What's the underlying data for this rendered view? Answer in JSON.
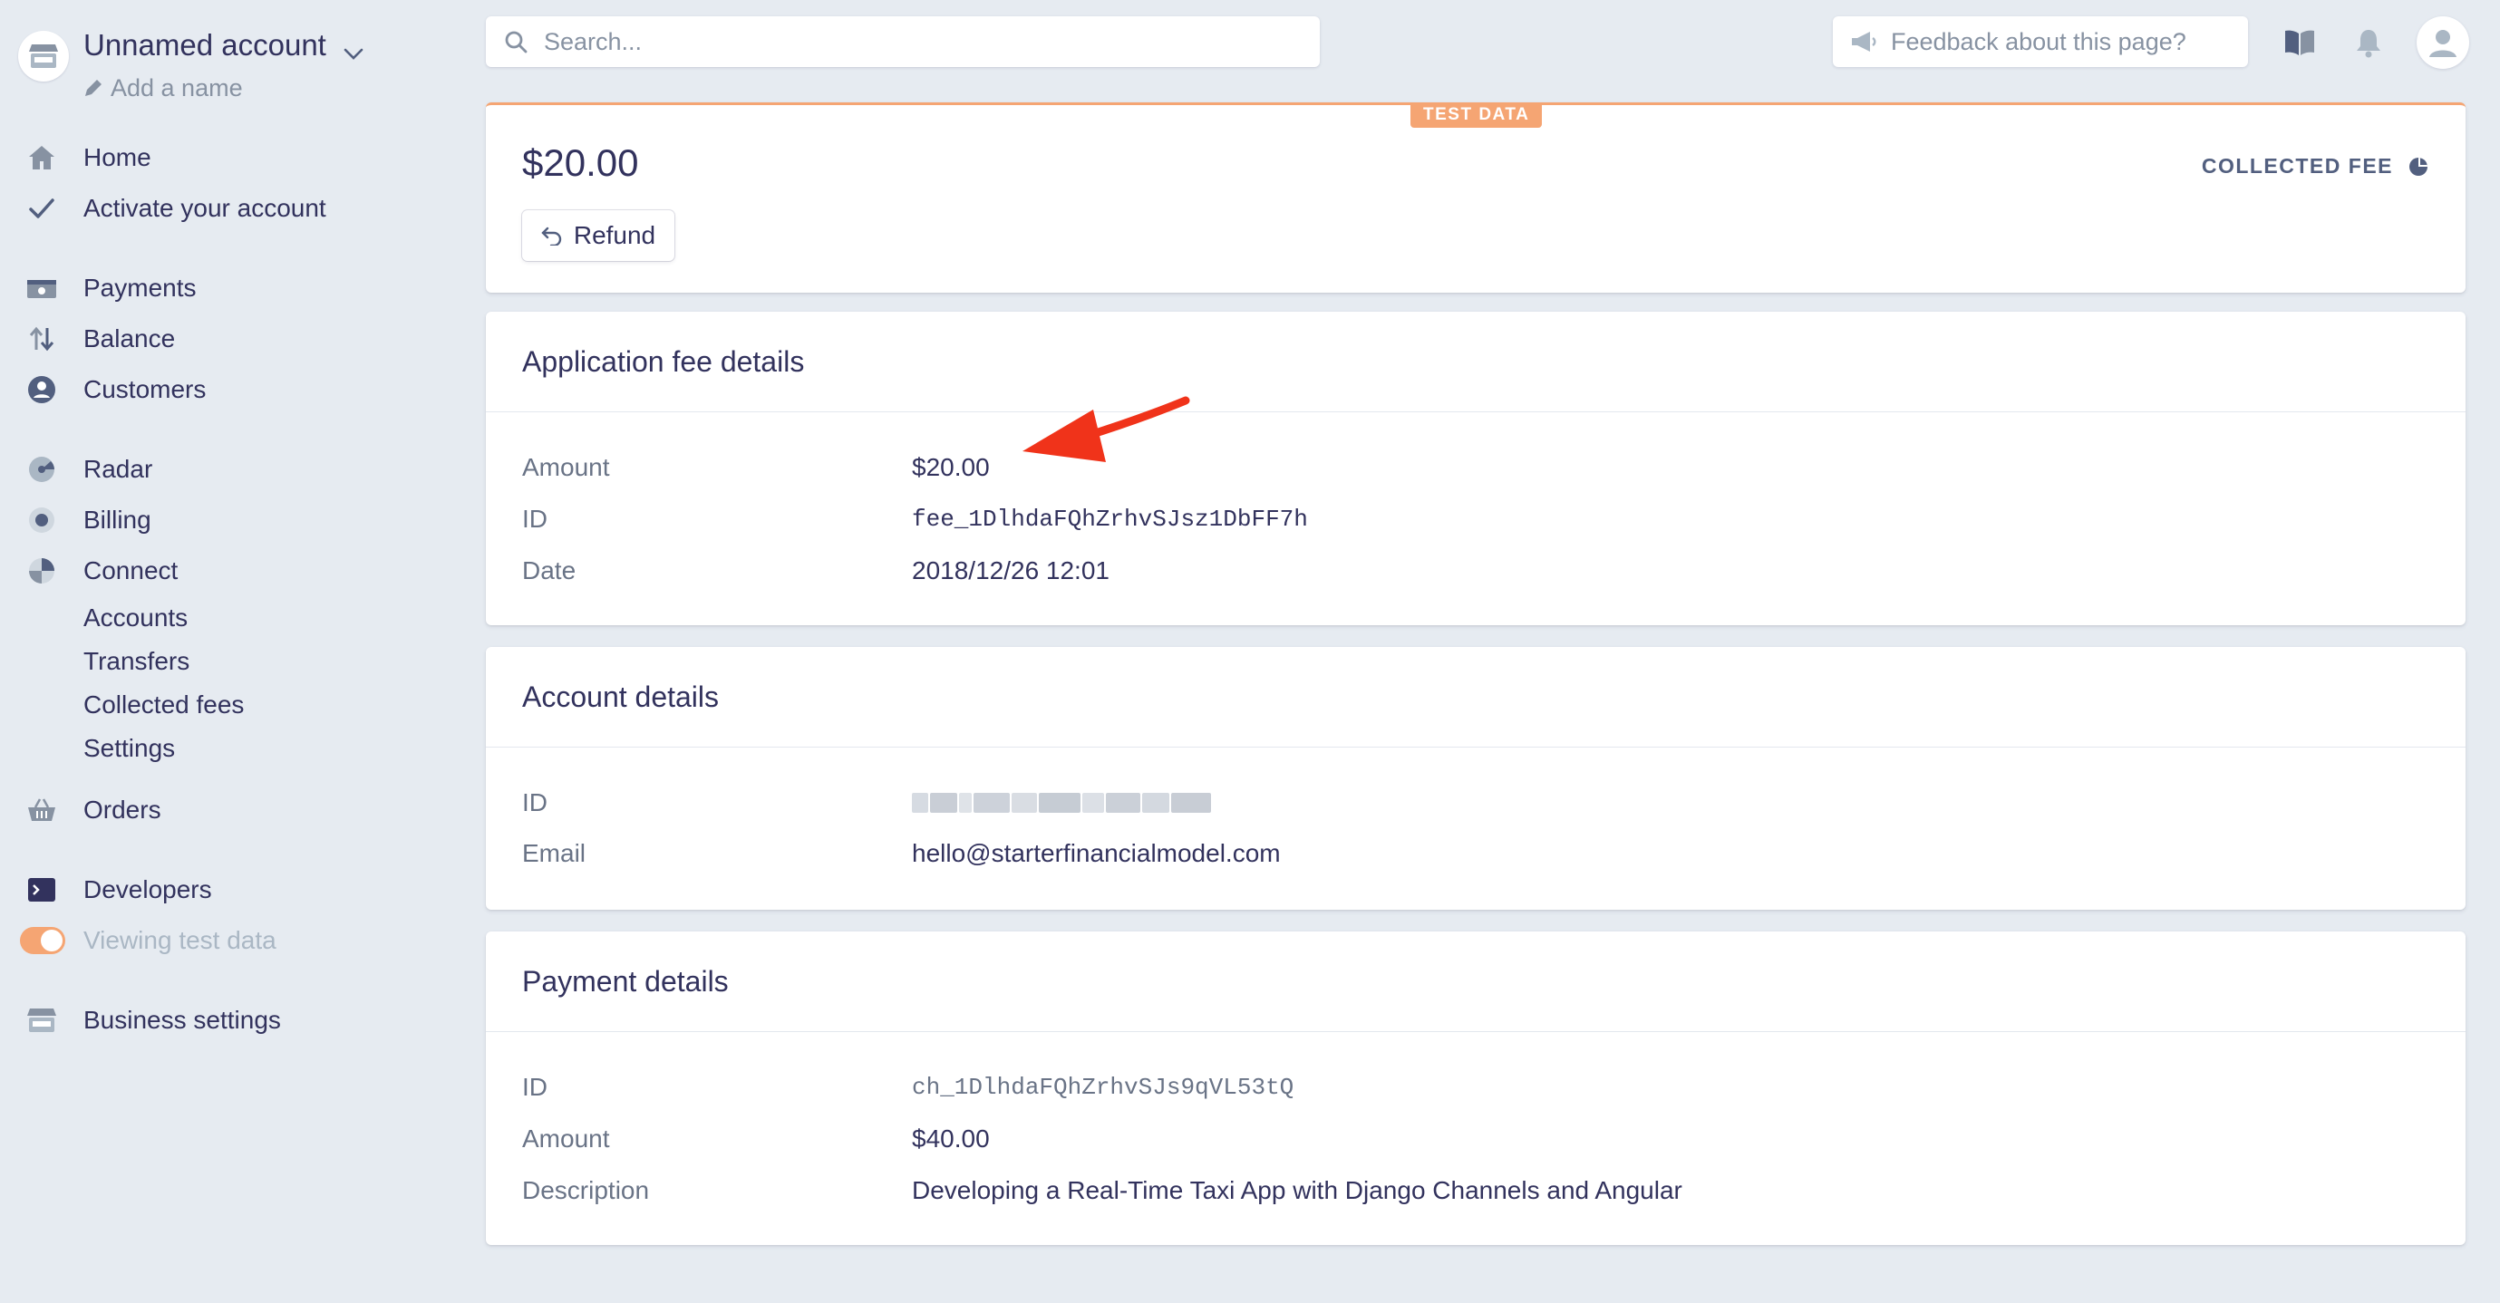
{
  "account": {
    "name": "Unnamed account",
    "add_name": "Add a name"
  },
  "nav": {
    "home": "Home",
    "activate": "Activate your account",
    "payments": "Payments",
    "balance": "Balance",
    "customers": "Customers",
    "radar": "Radar",
    "billing": "Billing",
    "connect": "Connect",
    "connect_sub": [
      "Accounts",
      "Transfers",
      "Collected fees",
      "Settings"
    ],
    "orders": "Orders",
    "developers": "Developers",
    "viewing_test_data": "Viewing test data",
    "business_settings": "Business settings"
  },
  "topbar": {
    "search_placeholder": "Search...",
    "feedback": "Feedback about this page?"
  },
  "header": {
    "badge": "TEST DATA",
    "amount": "$20.00",
    "refund": "Refund",
    "status": "COLLECTED FEE"
  },
  "fee_details": {
    "title": "Application fee details",
    "rows": [
      {
        "label": "Amount",
        "value": "$20.00"
      },
      {
        "label": "ID",
        "value": "fee_1DlhdaFQhZrhvSJsz1DbFF7h"
      },
      {
        "label": "Date",
        "value": "2018/12/26 12:01"
      }
    ]
  },
  "account_details": {
    "title": "Account details",
    "id_label": "ID",
    "email_label": "Email",
    "email": "hello@starterfinancialmodel.com"
  },
  "payment_details": {
    "title": "Payment details",
    "rows": [
      {
        "label": "ID",
        "value": "ch_1DlhdaFQhZrhvSJs9qVL53tQ"
      },
      {
        "label": "Amount",
        "value": "$40.00"
      },
      {
        "label": "Description",
        "value": "Developing a Real-Time Taxi App with Django Channels and Angular"
      }
    ]
  },
  "colors": {
    "accent_test": "#f5a573",
    "text_primary": "#32325d",
    "text_secondary": "#697386",
    "background": "#e6ebf1",
    "arrow": "#f0331a"
  },
  "icons": {
    "home": "home-icon",
    "activate": "check-icon",
    "payments": "payments-icon",
    "balance": "balance-arrows-icon",
    "customers": "customer-icon",
    "radar": "radar-icon",
    "billing": "billing-icon",
    "connect": "connect-icon",
    "orders": "basket-icon",
    "developers": "terminal-icon",
    "business_settings": "store-icon"
  }
}
